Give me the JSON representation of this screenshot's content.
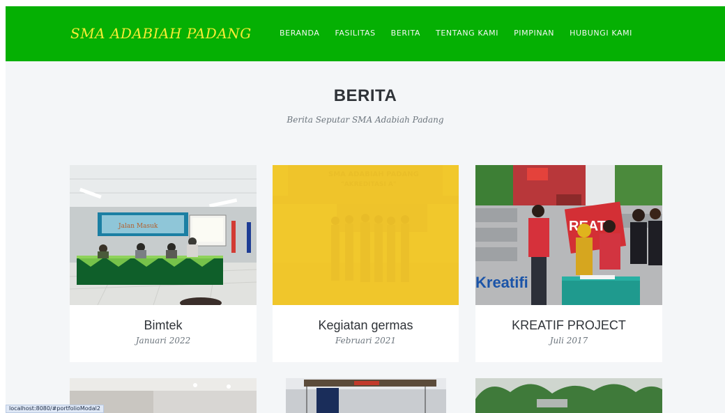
{
  "brand": "SMA ADABIAH PADANG",
  "nav": {
    "items": [
      "BERANDA",
      "FASILITAS",
      "BERITA",
      "TENTANG KAMI",
      "PIMPINAN",
      "HUBUNGI KAMI"
    ]
  },
  "section": {
    "title": "BERITA",
    "subtitle": "Berita Seputar SMA Adabiah Padang"
  },
  "cards": [
    {
      "title": "Bimtek",
      "date": "Januari 2022",
      "image": "photo-meeting-room"
    },
    {
      "title": "Kegiatan germas",
      "date": "Februari 2021",
      "image": "photo-school-front-yellow-overlay"
    },
    {
      "title": "KREATIF PROJECT",
      "date": "Juli 2017",
      "image": "photo-signing-event"
    }
  ],
  "status_bar": "localhost:8080/#portfolioModal2",
  "colors": {
    "navbar": "#05b003",
    "brand": "#f6ec34",
    "overlay": "#f2cb2c"
  }
}
